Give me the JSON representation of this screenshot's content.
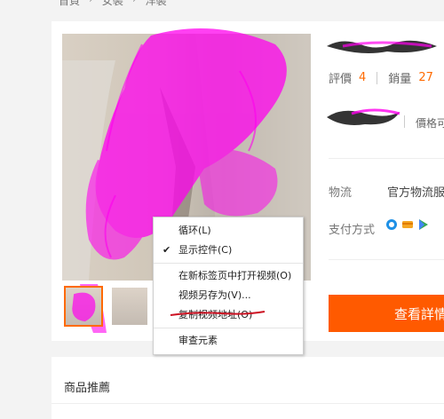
{
  "breadcrumb": {
    "items": [
      "首頁",
      "女裝",
      "洋裝"
    ],
    "separator": "›"
  },
  "stats": {
    "rating_label": "評價",
    "rating_value": "4",
    "sales_label": "銷量",
    "sales_value": "27"
  },
  "price": {
    "tail_text": "價格可"
  },
  "logistics": {
    "label": "物流",
    "value": "官方物流服裝"
  },
  "payment": {
    "label": "支付方式",
    "icons": [
      "pay-icon-blue",
      "pay-icon-orange",
      "pay-icon-green"
    ]
  },
  "detail_button": {
    "label": "查看詳情"
  },
  "recommend": {
    "title": "商品推薦"
  },
  "context_menu": {
    "items": [
      {
        "label": "循环(L)",
        "checked": false
      },
      {
        "label": "显示控件(C)",
        "checked": true
      },
      {
        "label": "在新标签页中打开视频(O)",
        "checked": false
      },
      {
        "label": "视频另存为(V)...",
        "checked": false
      },
      {
        "label": "复制视频地址(O)",
        "checked": false
      },
      {
        "label": "审查元素",
        "checked": false
      }
    ],
    "check_glyph": "✔"
  },
  "colors": {
    "accent": "#ff6a00",
    "button": "#ff5a00",
    "scribble": "#ff00ee",
    "annotation_line": "#cc1122"
  }
}
